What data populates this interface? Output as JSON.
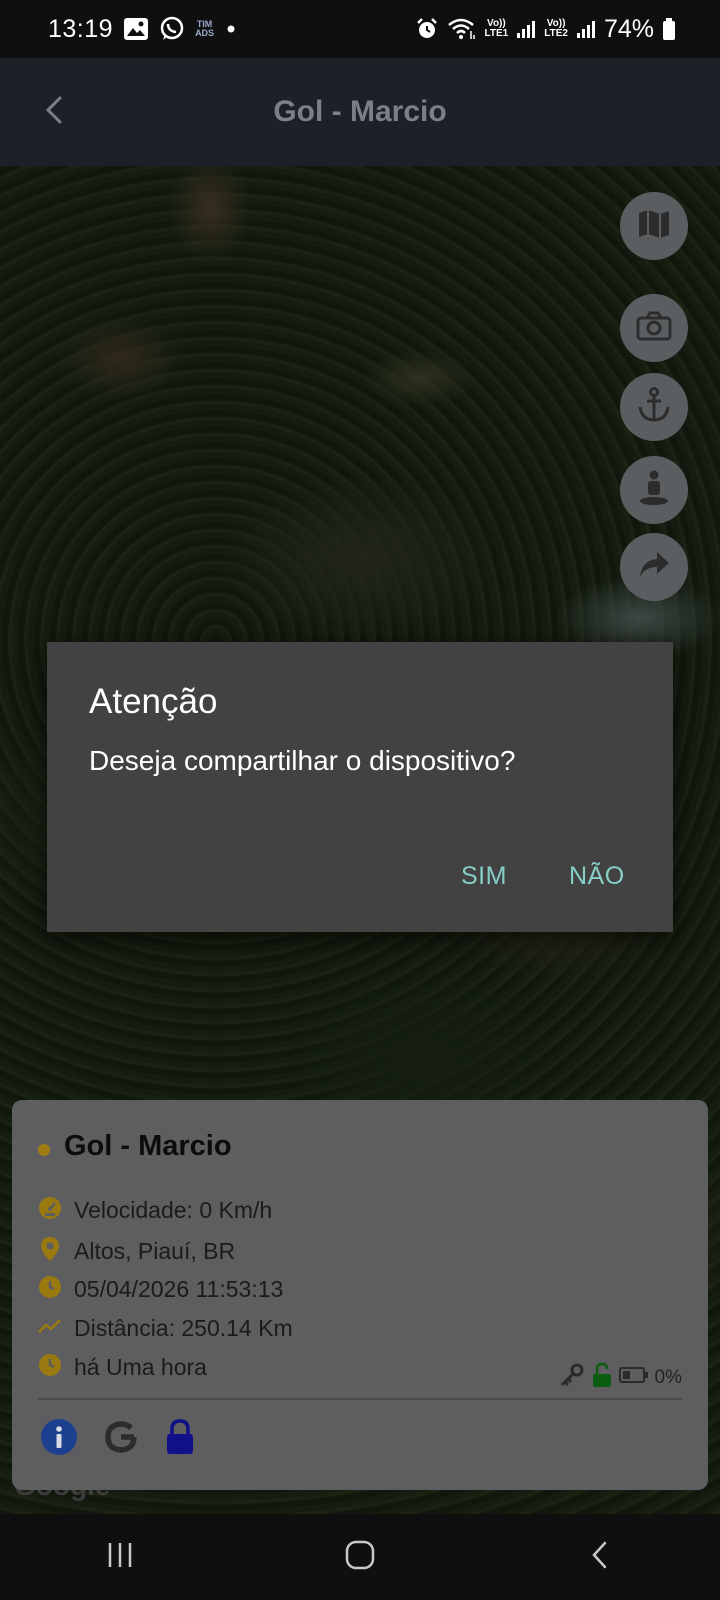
{
  "status_bar": {
    "time": "13:19",
    "carrier_badge_top": "TIM",
    "carrier_badge_bottom": "ADS",
    "sim1_label_top": "Vo))",
    "sim1_label_bottom": "LTE1",
    "sim2_label_top": "Vo))",
    "sim2_label_bottom": "LTE2",
    "battery": "74%",
    "icons": [
      "image-icon",
      "whatsapp-icon",
      "dot-icon",
      "alarm-icon",
      "wifi-icon",
      "signal-icon",
      "signal-icon",
      "battery-icon"
    ]
  },
  "app_bar": {
    "title": "Gol - Marcio",
    "back_icon": "chevron-left-icon"
  },
  "fabs": [
    {
      "name": "map-layers-button",
      "icon": "map-icon"
    },
    {
      "name": "camera-button",
      "icon": "camera-icon"
    },
    {
      "name": "anchor-button",
      "icon": "anchor-icon"
    },
    {
      "name": "street-view-button",
      "icon": "person-pin-icon"
    },
    {
      "name": "share-button",
      "icon": "share-arrow-icon"
    }
  ],
  "dialog": {
    "title": "Atenção",
    "message": "Deseja compartilhar o dispositivo?",
    "confirm_label": "SIM",
    "cancel_label": "NÃO",
    "accent_color": "#86cfc6"
  },
  "card": {
    "title": "Gol - Marcio",
    "status_color": "#a07d14",
    "speed": "Velocidade: 0 Km/h",
    "location": "Altos, Piauí, BR",
    "datetime": "05/04/2026 11:53:13",
    "distance": "Distância: 250.14 Km",
    "last_seen": "há Uma hora",
    "battery_percent": "0%",
    "icons": [
      "speedometer-icon",
      "location-pin-icon",
      "clock-icon",
      "trend-line-icon",
      "clock-icon",
      "key-icon",
      "unlock-icon",
      "battery-icon",
      "info-icon",
      "google-icon",
      "lock-icon"
    ]
  },
  "map": {
    "watermark": "Google"
  },
  "nav_bar": {
    "icons": [
      "recent-apps-icon",
      "home-icon",
      "back-icon"
    ]
  }
}
